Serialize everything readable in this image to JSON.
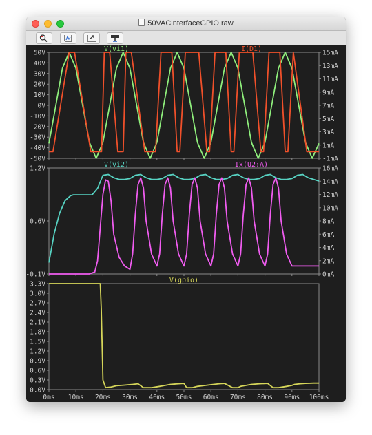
{
  "window": {
    "title": "50VACinterfaceGPIO.raw"
  },
  "toolbar": {
    "buttons": [
      "zoom-icon",
      "autorange-icon",
      "pan-icon",
      "measure-icon"
    ]
  },
  "colors": {
    "background": "#1e1e1e",
    "frame": "#8a8a8a",
    "text": "#cfcfcf",
    "green": "#8fef7c",
    "red": "#f0502a",
    "cyan": "#57d2c2",
    "magenta": "#f05cf0",
    "yellow": "#d6d65a"
  },
  "chart_data": [
    {
      "type": "line",
      "series": [
        {
          "name": "V(vi1)",
          "x": [
            0,
            2.5,
            5,
            7.5,
            10,
            12.5,
            15,
            17.5,
            20,
            22.5,
            25,
            27.5,
            30,
            32.5,
            35,
            37.5,
            40,
            42.5,
            45,
            47.5,
            50,
            52.5,
            55,
            57.5,
            60,
            62.5,
            65,
            67.5,
            70,
            72.5,
            75,
            77.5,
            80,
            82.5,
            85,
            87.5,
            90,
            92.5,
            95,
            97.5,
            100
          ],
          "y": [
            -36,
            -1,
            35,
            50,
            35,
            0,
            -35,
            -50,
            -35,
            0,
            35,
            50,
            35,
            0,
            -35,
            -50,
            -35,
            0,
            35,
            50,
            35,
            0,
            -35,
            -50,
            -35,
            0,
            35,
            50,
            35,
            0,
            -35,
            -50,
            -35,
            0,
            35,
            50,
            35,
            0,
            -35,
            -50,
            -36
          ]
        },
        {
          "name": "I(D1)",
          "x": [
            0,
            1.5,
            7.5,
            8.5,
            9.5,
            15.5,
            18.5,
            19.5,
            20.5,
            22.5,
            25.5,
            27.5,
            28.5,
            30.5,
            35.5,
            38.5,
            39.5,
            41.5,
            45.5,
            47.5,
            48.5,
            50.5,
            55.5,
            58.5,
            59.5,
            61.5,
            65.5,
            67.5,
            68.5,
            70.5,
            75.5,
            78.5,
            79.5,
            81.5,
            85.5,
            87.5,
            88.5,
            90.5,
            95.5,
            100
          ],
          "y": [
            0,
            0,
            15,
            15,
            15,
            0,
            0,
            0,
            15,
            15,
            0,
            0,
            15,
            15,
            0,
            0,
            0,
            15,
            15,
            0,
            0,
            15,
            15,
            0,
            0,
            15,
            15,
            0,
            0,
            15,
            15,
            0,
            0,
            15,
            15,
            0,
            0,
            15,
            0,
            0
          ]
        }
      ],
      "left_ticks": [
        "50V",
        "40V",
        "30V",
        "20V",
        "10V",
        "0V",
        "-10V",
        "-20V",
        "-30V",
        "-40V",
        "-50V"
      ],
      "right_ticks": [
        "15mA",
        "13mA",
        "11mA",
        "9mA",
        "7mA",
        "5mA",
        "3mA",
        "1mA",
        "-1mA"
      ],
      "ylim": [
        -50,
        50
      ],
      "y2lim": [
        -1,
        15
      ],
      "xlim": [
        0,
        100
      ]
    },
    {
      "type": "line",
      "series": [
        {
          "name": "V(vi2)",
          "x": [
            0,
            2,
            4,
            6,
            8,
            9,
            12,
            16,
            18,
            20,
            22,
            24,
            26,
            28,
            30,
            32,
            34,
            36,
            38,
            40,
            42,
            44,
            46,
            48,
            50,
            52,
            54,
            56,
            58,
            60,
            62,
            64,
            66,
            68,
            70,
            72,
            74,
            76,
            78,
            80,
            82,
            84,
            86,
            88,
            90,
            92,
            94,
            96,
            98,
            100
          ],
          "y": [
            0.04,
            0.4,
            0.65,
            0.8,
            0.86,
            0.87,
            0.87,
            0.87,
            0.95,
            1.11,
            1.12,
            1.08,
            1.06,
            1.06,
            1.07,
            1.11,
            1.12,
            1.08,
            1.06,
            1.06,
            1.07,
            1.11,
            1.12,
            1.08,
            1.06,
            1.06,
            1.07,
            1.11,
            1.12,
            1.08,
            1.06,
            1.06,
            1.07,
            1.11,
            1.12,
            1.08,
            1.06,
            1.06,
            1.07,
            1.11,
            1.12,
            1.08,
            1.06,
            1.06,
            1.07,
            1.11,
            1.12,
            1.08,
            1.06,
            1.04
          ]
        },
        {
          "name": "Ix(U2:A)",
          "x": [
            0,
            5,
            10,
            15,
            17,
            18,
            19,
            20,
            21,
            22,
            23,
            24,
            26,
            28,
            30,
            31,
            32,
            33,
            34,
            35,
            36,
            38,
            40,
            41,
            42,
            43,
            44,
            45,
            46,
            48,
            50,
            51,
            52,
            53,
            54,
            55,
            56,
            58,
            60,
            61,
            62,
            63,
            64,
            65,
            66,
            68,
            70,
            71,
            72,
            73,
            74,
            75,
            76,
            78,
            80,
            81,
            82,
            83,
            84,
            85,
            86,
            88,
            90,
            100
          ],
          "y": [
            0,
            0,
            0,
            0,
            0.3,
            2,
            7,
            12,
            14.2,
            14,
            11,
            6,
            2.5,
            1.2,
            0.7,
            3,
            9,
            13.5,
            14.5,
            13,
            8,
            3,
            1.2,
            3,
            9,
            13.5,
            14.5,
            13,
            8,
            3,
            1.2,
            3,
            9,
            13.5,
            14.5,
            13,
            8,
            3,
            1.2,
            3,
            9,
            13.5,
            14.5,
            13,
            8,
            3,
            1.2,
            3,
            9,
            13.5,
            14.5,
            13,
            8,
            3,
            1.2,
            3,
            9,
            13.5,
            14.5,
            13,
            8,
            3,
            1.2,
            1.2
          ]
        }
      ],
      "left_ticks": [
        "1.2V",
        "0.6V",
        "-0.1V"
      ],
      "right_ticks": [
        "16mA",
        "14mA",
        "12mA",
        "10mA",
        "8mA",
        "6mA",
        "4mA",
        "2mA",
        "0mA"
      ],
      "ylim": [
        -0.1,
        1.2
      ],
      "y2lim": [
        0,
        16
      ],
      "xlim": [
        0,
        100
      ]
    },
    {
      "type": "line",
      "series": [
        {
          "name": "V(gpio)",
          "x": [
            0,
            19,
            19.4,
            20,
            21,
            23,
            25,
            28,
            31,
            33,
            35,
            38,
            41,
            43,
            45,
            48,
            50,
            51,
            53,
            55,
            58,
            61,
            63,
            65,
            68,
            70,
            71,
            73,
            75,
            78,
            81,
            83,
            85,
            88,
            90,
            91,
            93,
            95,
            98,
            100
          ],
          "y": [
            3.3,
            3.3,
            2.5,
            0.3,
            0.06,
            0.08,
            0.12,
            0.14,
            0.16,
            0.18,
            0.06,
            0.06,
            0.1,
            0.13,
            0.16,
            0.18,
            0.19,
            0.06,
            0.06,
            0.1,
            0.13,
            0.16,
            0.18,
            0.19,
            0.06,
            0.06,
            0.1,
            0.13,
            0.16,
            0.18,
            0.19,
            0.06,
            0.06,
            0.1,
            0.13,
            0.16,
            0.18,
            0.19,
            0.2,
            0.2
          ]
        }
      ],
      "left_ticks": [
        "3.3V",
        "3.0V",
        "2.7V",
        "2.4V",
        "2.1V",
        "1.8V",
        "1.5V",
        "1.2V",
        "0.9V",
        "0.6V",
        "0.3V",
        "0.0V"
      ],
      "ylim": [
        0,
        3.3
      ],
      "xlim": [
        0,
        100
      ],
      "x_ticks": [
        "0ms",
        "10ms",
        "20ms",
        "30ms",
        "40ms",
        "50ms",
        "60ms",
        "70ms",
        "80ms",
        "90ms",
        "100ms"
      ]
    }
  ]
}
